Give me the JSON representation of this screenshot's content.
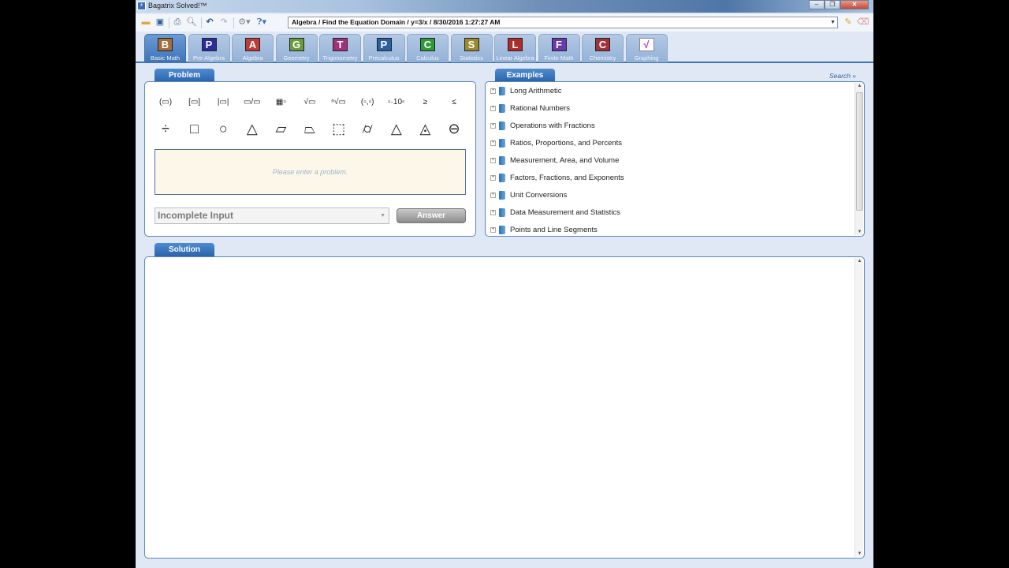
{
  "window": {
    "title": "Bagatrix Solved!™",
    "controls": {
      "minimize": "–",
      "restore": "❐",
      "close": "✕"
    }
  },
  "toolbar": {
    "icons": [
      "open-folder-icon",
      "save-icon",
      "print-icon",
      "print-preview-icon",
      "undo-icon",
      "redo-icon",
      "settings-icon",
      "help-icon"
    ],
    "breadcrumb": "Algebra  /  Find the Equation Domain  /  y=3/x  /  8/30/2016 1:27:27 AM",
    "pencil_label": "✎",
    "eraser_label": "⌫"
  },
  "subjects": [
    {
      "letter": "B",
      "label": "Basic Math",
      "color": "#a0703a",
      "active": true
    },
    {
      "letter": "P",
      "label": "Pre-Algebra",
      "color": "#2a2d9a"
    },
    {
      "letter": "A",
      "label": "Algebra",
      "color": "#c03a3a"
    },
    {
      "letter": "G",
      "label": "Geometry",
      "color": "#6a9a3a"
    },
    {
      "letter": "T",
      "label": "Trigonometry",
      "color": "#a0307a"
    },
    {
      "letter": "P",
      "label": "Precalculus",
      "color": "#2a5fa0"
    },
    {
      "letter": "C",
      "label": "Calculus",
      "color": "#2e9a3a"
    },
    {
      "letter": "S",
      "label": "Statistics",
      "color": "#9a8a2a"
    },
    {
      "letter": "L",
      "label": "Linear Algebra",
      "color": "#b02a2a"
    },
    {
      "letter": "F",
      "label": "Finite Math",
      "color": "#6a3aaa"
    },
    {
      "letter": "C",
      "label": "Chemistry",
      "color": "#a0303a"
    },
    {
      "letter": "√",
      "label": "Graphing",
      "color": "#ffffff"
    }
  ],
  "problem": {
    "tab_label": "Problem",
    "templates_row1": [
      "(▭)",
      "[▭]",
      "|▭|",
      "▭/▭",
      "▦▫",
      "√▭",
      "ⁿ√▭",
      "(▫,▫)",
      "▫·10▫",
      "≥",
      "≤"
    ],
    "templates_row1_names": [
      "parentheses",
      "brackets",
      "absolute-value",
      "fraction",
      "matrix-power",
      "square-root",
      "nth-root",
      "ordered-pair",
      "scientific-notation",
      "greater-equal",
      "less-equal"
    ],
    "templates_row2": [
      "÷",
      "□",
      "○",
      "△",
      "▱",
      "⏢",
      "⬚",
      "⌭",
      "△",
      "◬",
      "⊖"
    ],
    "templates_row2_names": [
      "divide",
      "square",
      "circle",
      "triangle",
      "parallelogram",
      "trapezoid",
      "cube",
      "cylinder",
      "cone",
      "pyramid",
      "sphere"
    ],
    "input_placeholder": "Please enter a problem.",
    "status_value": "Incomplete Input",
    "answer_label": "Answer"
  },
  "examples": {
    "tab_label": "Examples",
    "search_label": "Search »",
    "items": [
      "Long Arithmetic",
      "Rational Numbers",
      "Operations with Fractions",
      "Ratios, Proportions, and Percents",
      "Measurement, Area, and Volume",
      "Factors, Fractions, and Exponents",
      "Unit Conversions",
      "Data Measurement and Statistics",
      "Points and Line Segments"
    ]
  },
  "solution": {
    "tab_label": "Solution"
  },
  "colors": {
    "accent": "#2a64ab",
    "panel_border": "#5a86bf",
    "input_bg": "#fdf7ea"
  }
}
